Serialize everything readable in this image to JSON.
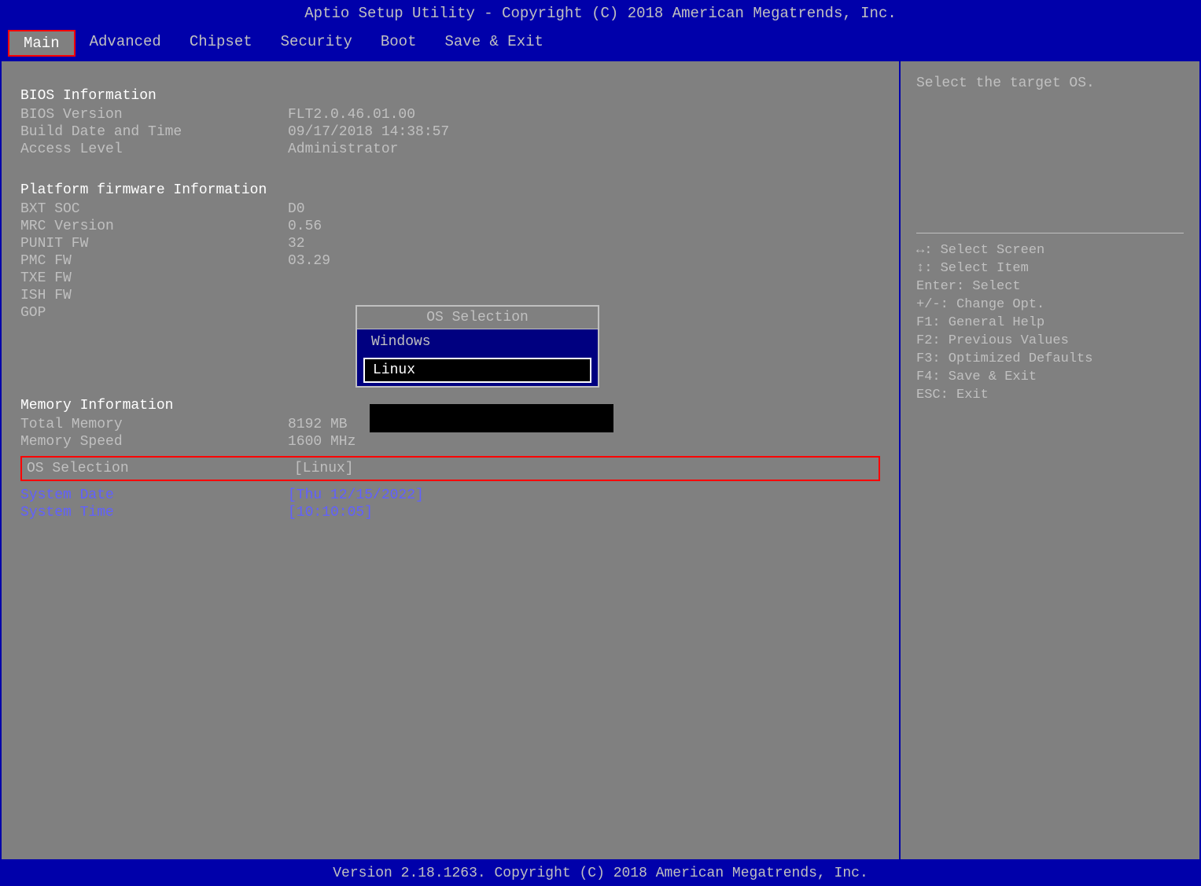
{
  "titleBar": {
    "text": "Aptio Setup Utility - Copyright (C) 2018 American Megatrends, Inc."
  },
  "menuBar": {
    "items": [
      {
        "label": "Main",
        "active": true
      },
      {
        "label": "Advanced",
        "active": false
      },
      {
        "label": "Chipset",
        "active": false
      },
      {
        "label": "Security",
        "active": false
      },
      {
        "label": "Boot",
        "active": false
      },
      {
        "label": "Save & Exit",
        "active": false
      }
    ]
  },
  "leftPanel": {
    "biosInfoHeader": "BIOS Information",
    "biosVersion": {
      "label": "BIOS Version",
      "value": "FLT2.0.46.01.00"
    },
    "buildDate": {
      "label": "Build Date and Time",
      "value": "09/17/2018 14:38:57"
    },
    "accessLevel": {
      "label": "Access Level",
      "value": "Administrator"
    },
    "platformHeader": "Platform firmware Information",
    "bxtSoc": {
      "label": "BXT SOC",
      "value": "D0"
    },
    "mrcVersion": {
      "label": "MRC Version",
      "value": "0.56"
    },
    "punitFw": {
      "label": "PUNIT FW",
      "value": "32"
    },
    "pmcFw": {
      "label": "PMC FW",
      "value": "03.29"
    },
    "txeFw": {
      "label": "TXE FW",
      "value": ""
    },
    "ishFw": {
      "label": "ISH FW",
      "value": ""
    },
    "gop": {
      "label": "GOP",
      "value": ""
    },
    "memoryHeader": "Memory Information",
    "totalMemory": {
      "label": "Total Memory",
      "value": "8192 MB"
    },
    "memorySpeed": {
      "label": "Memory Speed",
      "value": "1600 MHz"
    },
    "osSelection": {
      "label": "OS Selection",
      "value": "[Linux]"
    },
    "systemDate": {
      "label": "System Date",
      "value": "[Thu 12/15/2022]"
    },
    "systemTime": {
      "label": "System Time",
      "value": "[10:10:05]"
    }
  },
  "osPopup": {
    "title": "OS Selection",
    "items": [
      {
        "label": "Windows",
        "selected": false
      },
      {
        "label": "Linux",
        "selected": true
      }
    ]
  },
  "rightPanel": {
    "helpText": "Select the target OS.",
    "keys": [
      {
        "key": "↔: Select Screen"
      },
      {
        "key": "↕: Select Item"
      },
      {
        "key": "Enter: Select"
      },
      {
        "key": "+/-: Change Opt."
      },
      {
        "key": "F1: General Help"
      },
      {
        "key": "F2: Previous Values"
      },
      {
        "key": "F3: Optimized Defaults"
      },
      {
        "key": "F4: Save & Exit"
      },
      {
        "key": "ESC: Exit"
      }
    ]
  },
  "footer": {
    "text": "Version 2.18.1263. Copyright (C) 2018 American Megatrends, Inc."
  }
}
